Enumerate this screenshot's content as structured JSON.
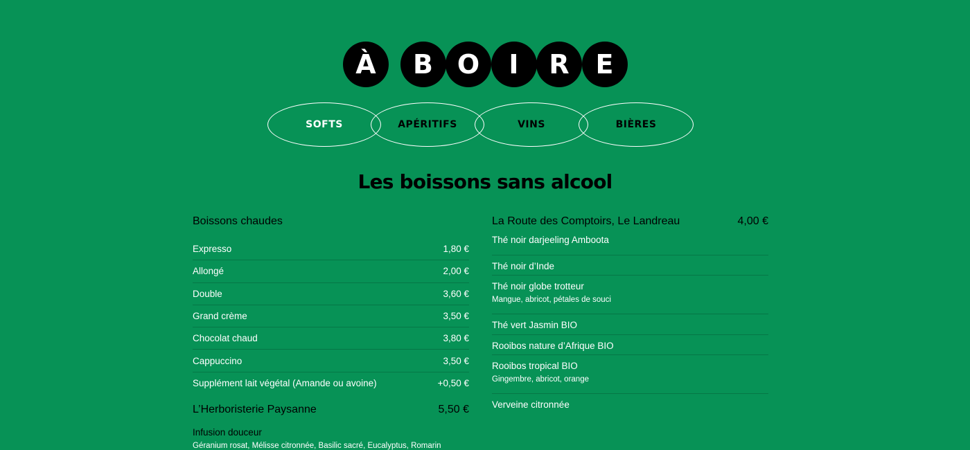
{
  "hero": {
    "letters_1": [
      "À"
    ],
    "letters_2": [
      "B",
      "O",
      "I",
      "R",
      "E"
    ]
  },
  "tabs": [
    {
      "label": "SOFTS",
      "active": true
    },
    {
      "label": "APÉRITIFS",
      "active": false
    },
    {
      "label": "VINS",
      "active": false
    },
    {
      "label": "BIÈRES",
      "active": false
    }
  ],
  "section": {
    "title": "Les boissons sans alcool"
  },
  "hot_drinks": {
    "title": "Boissons chaudes",
    "items": [
      {
        "name": "Expresso",
        "price": "1,80 €"
      },
      {
        "name": "Allongé",
        "price": "2,00 €"
      },
      {
        "name": "Double",
        "price": "3,60 €"
      },
      {
        "name": "Grand crème",
        "price": "3,50 €"
      },
      {
        "name": "Chocolat chaud",
        "price": "3,80 €"
      },
      {
        "name": "Cappuccino",
        "price": "3,50 €"
      },
      {
        "name": "Supplément lait végétal (Amande ou avoine)",
        "price": "+0,50 €"
      }
    ]
  },
  "herboristerie": {
    "title": "L’Herboristerie Paysanne",
    "price": "5,50 €",
    "sub_title": "Infusion douceur",
    "sub_desc": "Géranium rosat, Mélisse citronnée, Basilic sacré, Eucalyptus, Romarin"
  },
  "teas": {
    "title": "La Route des Comptoirs, Le Landreau",
    "price": "4,00 €",
    "items": [
      {
        "name": "Thé noir darjeeling Amboota",
        "desc": ""
      },
      {
        "name": "Thé noir d’Inde",
        "desc": ""
      },
      {
        "name": "Thé noir globe trotteur",
        "desc": "Mangue, abricot, pétales de souci"
      },
      {
        "name": "Thé vert Jasmin BIO",
        "desc": ""
      },
      {
        "name": "Rooibos nature d’Afrique BIO",
        "desc": ""
      },
      {
        "name": "Rooibos tropical BIO",
        "desc": "Gingembre, abricot, orange"
      },
      {
        "name": "Verveine citronnée",
        "desc": ""
      }
    ]
  },
  "colors": {
    "background": "#079256",
    "accent": "#000000",
    "text_light": "#ffffff"
  }
}
